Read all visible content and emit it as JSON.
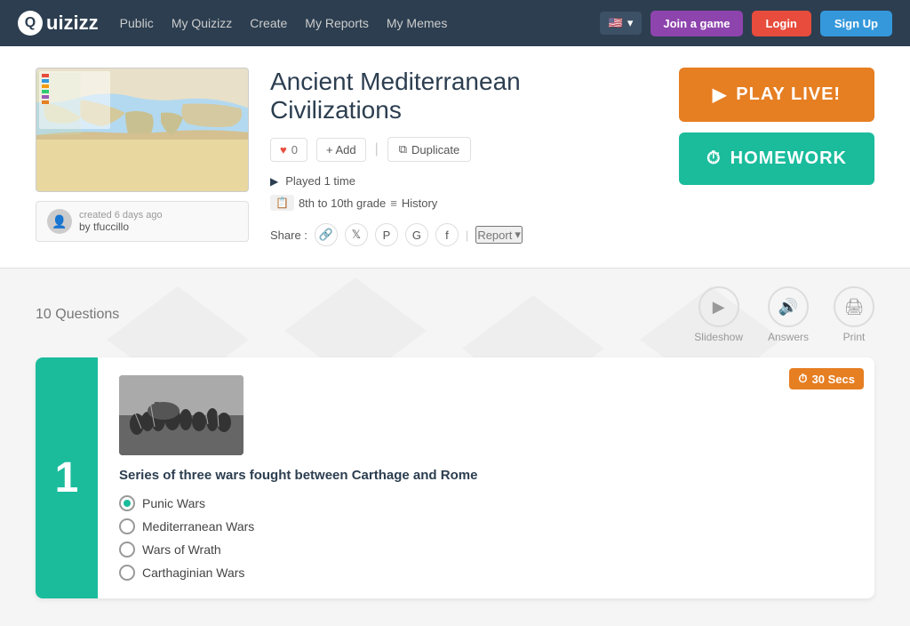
{
  "navbar": {
    "logo": "Quizizz",
    "links": [
      "Public",
      "My Quizizz",
      "Create",
      "My Reports",
      "My Memes"
    ],
    "flag": "🇺🇸",
    "join_label": "Join a game",
    "login_label": "Login",
    "signup_label": "Sign Up"
  },
  "quiz": {
    "title": "Ancient Mediterranean Civilizations",
    "likes": "0",
    "add_label": "+ Add",
    "duplicate_label": "Duplicate",
    "played_time": "Played 1 time",
    "grade": "8th to 10th grade",
    "subject": "History",
    "creator_time": "created 6 days ago",
    "creator_name": "by tfuccillo",
    "share_label": "Share :",
    "report_label": "Report",
    "play_live_label": "PLAY LIVE!",
    "homework_label": "HOMEWORK"
  },
  "questions_section": {
    "count_label": "10 Questions",
    "tools": [
      {
        "label": "Slideshow",
        "icon": "▶"
      },
      {
        "label": "Answers",
        "icon": "🔊"
      },
      {
        "label": "Print",
        "icon": "🖨"
      }
    ]
  },
  "question": {
    "number": "1",
    "timer": "30 Secs",
    "text": "Series of three wars fought between Carthage and Rome",
    "answers": [
      {
        "label": "Punic Wars",
        "correct": true
      },
      {
        "label": "Mediterranean Wars",
        "correct": false
      },
      {
        "label": "Wars of Wrath",
        "correct": false
      },
      {
        "label": "Carthaginian Wars",
        "correct": false
      }
    ]
  }
}
